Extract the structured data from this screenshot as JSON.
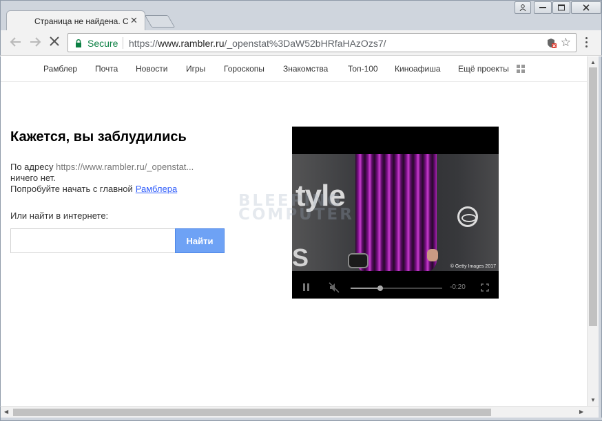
{
  "browser": {
    "tab_title": "Страница не найдена. С",
    "tab_close": "✕",
    "address": {
      "secure_label": "Secure",
      "scheme": "https://",
      "host": "www.rambler.ru",
      "path": "/_openstat%3DaW52bHRfaHAzOzs7/"
    }
  },
  "nav": {
    "items": [
      "Рамблер",
      "Почта",
      "Новости",
      "Игры",
      "Гороскопы",
      "Знакомства",
      "Топ-100",
      "Киноафиша",
      "Ещё проекты"
    ]
  },
  "page": {
    "heading": "Кажется, вы заблудились",
    "address_prefix": "По адресу",
    "address_url": "https://www.rambler.ru/_openstat...",
    "nothing": "ничего нет.",
    "try_text": "Попробуйте начать с главной",
    "try_link": "Рамблера",
    "or_search": "Или найти в интернете:",
    "search_placeholder": "",
    "search_button": "Найти"
  },
  "video": {
    "bg_text": "tyle",
    "bg_text2": "S",
    "copyright": "© Getty Images 2017",
    "time": "-0:20",
    "progress": 0.32,
    "muted": true,
    "playing": true
  },
  "watermark": {
    "line1": "BLEEPING",
    "line2": "COMPUTER"
  },
  "icons": {
    "lock": "lock-icon",
    "star": "star-icon",
    "grid": "apps-grid-icon",
    "reload": "stop-icon"
  },
  "colors": {
    "secure": "#0b8043",
    "link": "#315efb",
    "button": "#6ea2f5",
    "dress": "#c93dcf"
  }
}
